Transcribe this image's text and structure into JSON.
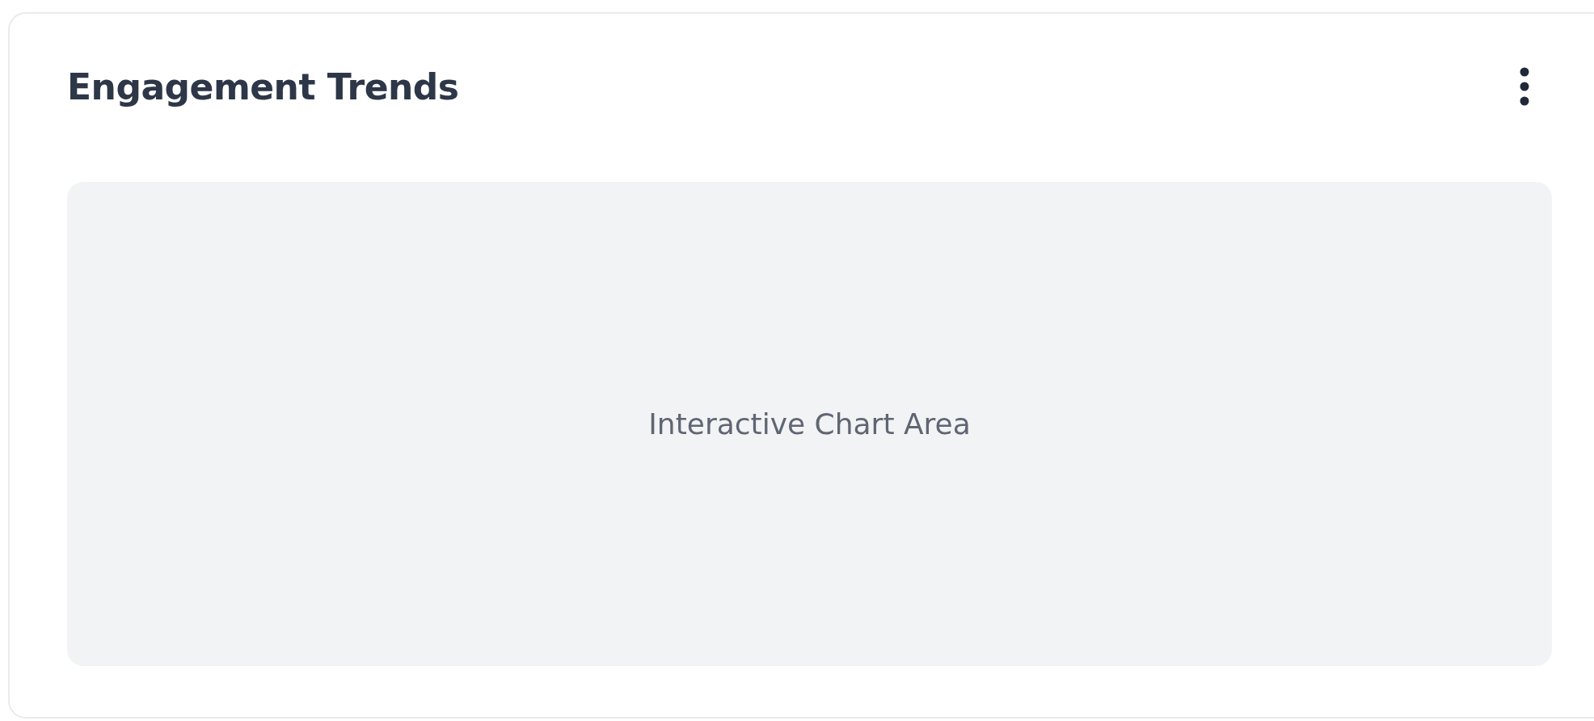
{
  "card": {
    "title": "Engagement Trends",
    "chart_placeholder": "Interactive Chart Area"
  }
}
